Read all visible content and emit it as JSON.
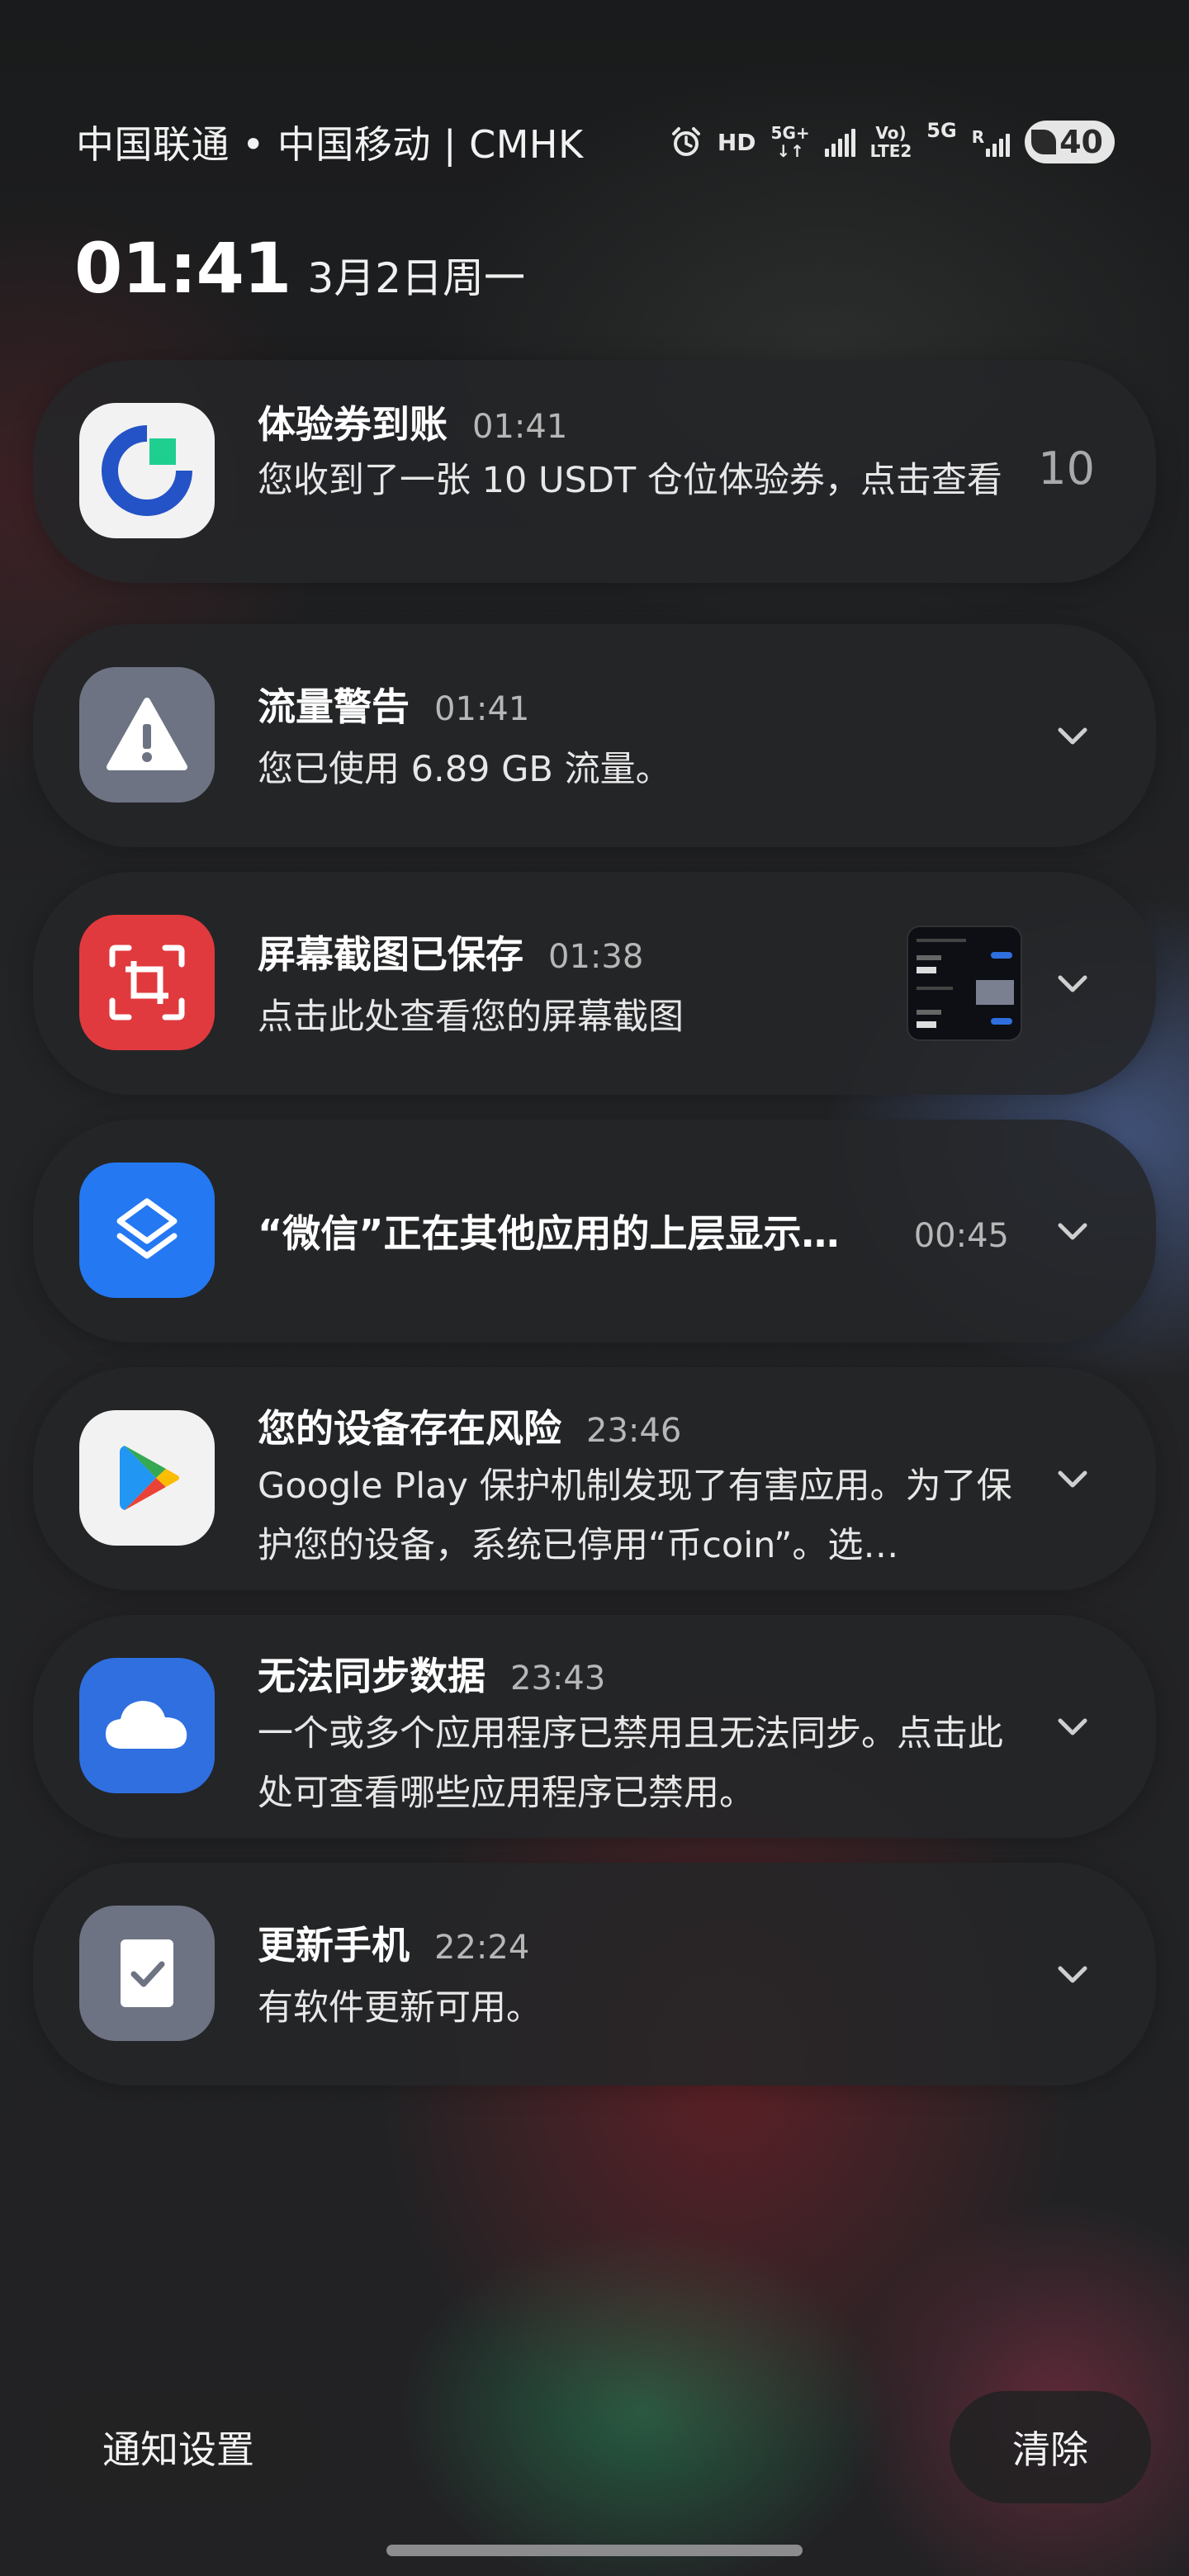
{
  "status_bar": {
    "carriers": "中国联通 • 中国移动 | CMHK",
    "hd": "HD",
    "net1_top": "5G+",
    "net2_top": "Vo)",
    "net2_bottom": "LTE2",
    "net3": "5G",
    "roaming": "R",
    "battery": "40"
  },
  "header": {
    "time": "01:41",
    "date": "3月2日周一"
  },
  "notifications": [
    {
      "title": "体验券到账",
      "time": "01:41",
      "body": "您收到了一张 10 USDT 仓位体验券，点击查看",
      "count": "10",
      "icon": "crypto-exchange-icon"
    },
    {
      "title": "流量警告",
      "time": "01:41",
      "body": "您已使用 6.89 GB 流量。",
      "icon": "warning-icon"
    },
    {
      "title": "屏幕截图已保存",
      "time": "01:38",
      "body": "点击此处查看您的屏幕截图",
      "icon": "screenshot-icon"
    },
    {
      "title": "“微信”正在其他应用的上层显示…",
      "time": "00:45",
      "icon": "layers-icon"
    },
    {
      "title": "您的设备存在风险",
      "time": "23:46",
      "body": "Google Play 保护机制发现了有害应用。为了保护您的设备，系统已停用“币coin”。选…",
      "icon": "google-play-icon"
    },
    {
      "title": "无法同步数据",
      "time": "23:43",
      "body": "一个或多个应用程序已禁用且无法同步。点击此处可查看哪些应用程序已禁用。",
      "icon": "cloud-icon"
    },
    {
      "title": "更新手机",
      "time": "22:24",
      "body": "有软件更新可用。",
      "icon": "software-update-icon"
    }
  ],
  "footer": {
    "settings_label": "通知设置",
    "clear_label": "清除"
  },
  "colors": {
    "card_bg": "#242528",
    "exchange_blue": "#2453c7",
    "exchange_green": "#1fcf8f",
    "warning_gray": "#6d7383",
    "screenshot_red": "#e03a3e",
    "layers_blue": "#2478f2",
    "cloud_blue": "#2f6fe0"
  }
}
